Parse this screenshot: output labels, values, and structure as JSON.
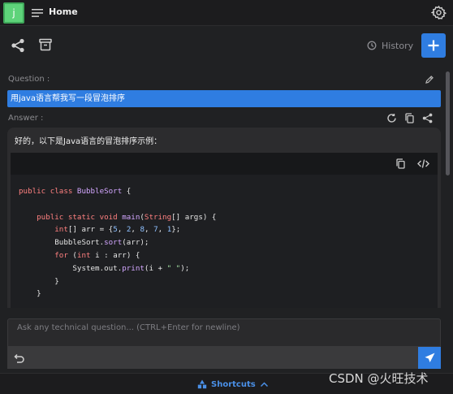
{
  "header": {
    "avatar_letter": "j",
    "home_label": "Home"
  },
  "toolbar": {
    "history_label": "History"
  },
  "question": {
    "label": "Question :",
    "text": "用java语言帮我写一段冒泡排序"
  },
  "answer": {
    "label": "Answer :",
    "intro": "好的，以下是Java语言的冒泡排序示例："
  },
  "code": {
    "language": "java",
    "lines": [
      [
        {
          "t": "public class ",
          "c": "kw"
        },
        {
          "t": "BubbleSort",
          "c": "fn"
        },
        {
          "t": " {",
          "c": ""
        }
      ],
      [],
      [
        {
          "t": "    public static void ",
          "c": "kw"
        },
        {
          "t": "main",
          "c": "fn"
        },
        {
          "t": "(",
          "c": ""
        },
        {
          "t": "String",
          "c": "kw"
        },
        {
          "t": "[] args) {",
          "c": ""
        }
      ],
      [
        {
          "t": "        ",
          "c": ""
        },
        {
          "t": "int",
          "c": "kw"
        },
        {
          "t": "[] arr = {",
          "c": ""
        },
        {
          "t": "5",
          "c": "num"
        },
        {
          "t": ", ",
          "c": ""
        },
        {
          "t": "2",
          "c": "num"
        },
        {
          "t": ", ",
          "c": ""
        },
        {
          "t": "8",
          "c": "num"
        },
        {
          "t": ", ",
          "c": ""
        },
        {
          "t": "7",
          "c": "num"
        },
        {
          "t": ", ",
          "c": ""
        },
        {
          "t": "1",
          "c": "num"
        },
        {
          "t": "};",
          "c": ""
        }
      ],
      [
        {
          "t": "        BubbleSort.",
          "c": ""
        },
        {
          "t": "sort",
          "c": "fn"
        },
        {
          "t": "(arr);",
          "c": ""
        }
      ],
      [
        {
          "t": "        ",
          "c": ""
        },
        {
          "t": "for",
          "c": "kw"
        },
        {
          "t": " (",
          "c": ""
        },
        {
          "t": "int",
          "c": "kw"
        },
        {
          "t": " i : arr) {",
          "c": ""
        }
      ],
      [
        {
          "t": "            System.out.",
          "c": ""
        },
        {
          "t": "print",
          "c": "fn"
        },
        {
          "t": "(i + ",
          "c": ""
        },
        {
          "t": "\" \"",
          "c": "str"
        },
        {
          "t": ");",
          "c": ""
        }
      ],
      [
        {
          "t": "        }",
          "c": ""
        }
      ],
      [
        {
          "t": "    }",
          "c": ""
        }
      ]
    ]
  },
  "input": {
    "placeholder": "Ask any technical question... (CTRL+Enter for newline)"
  },
  "footer": {
    "shortcuts_label": "Shortcuts",
    "watermark": "CSDN @火旺技术"
  },
  "colors": {
    "accent": "#2f7de1",
    "avatar": "#5ed37a",
    "background": "#202123"
  }
}
